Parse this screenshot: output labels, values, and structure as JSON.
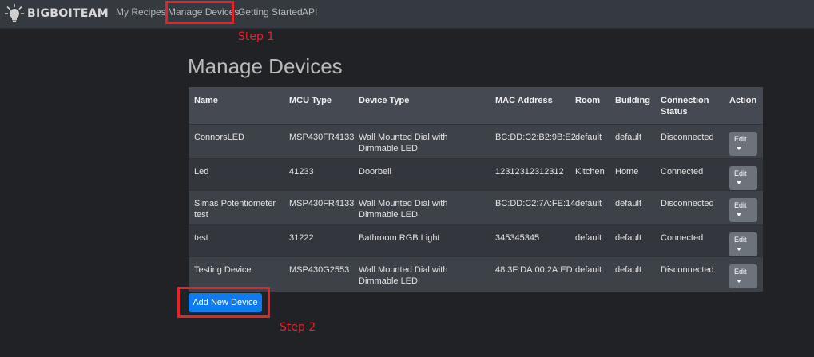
{
  "navbar": {
    "brand": "BIGBOITEAM",
    "links": [
      "My Recipes",
      "Manage Devices",
      "Getting Started",
      "API"
    ],
    "active": "Manage Devices"
  },
  "annotations": {
    "step1": "Step 1",
    "step2": "Step 2",
    "color": "#e0262b"
  },
  "page_title": "Manage Devices",
  "table": {
    "headers": [
      "Name",
      "MCU Type",
      "Device Type",
      "MAC Address",
      "Room",
      "Building",
      "Connection Status",
      "Action"
    ],
    "rows": [
      [
        "ConnorsLED",
        "MSP430FR4133",
        "Wall Mounted Dial with Dimmable LED",
        "BC:DD:C2:B2:9B:E2",
        "default",
        "default",
        "Disconnected",
        "Edit"
      ],
      [
        "Led",
        "41233",
        "Doorbell",
        "12312312312312",
        "Kitchen",
        "Home",
        "Connected",
        "Edit"
      ],
      [
        "Simas Potentiometer test",
        "MSP430FR4133",
        "Wall Mounted Dial with Dimmable LED",
        "BC:DD:C2:7A:FE:14",
        "default",
        "default",
        "Disconnected",
        "Edit"
      ],
      [
        "test",
        "31222",
        "Bathroom RGB Light",
        "345345345",
        "default",
        "default",
        "Connected",
        "Edit"
      ],
      [
        "Testing Device",
        "MSP430G2553",
        "Wall Mounted Dial with Dimmable LED",
        "48:3F:DA:00:2A:ED",
        "default",
        "default",
        "Disconnected",
        "Edit"
      ]
    ]
  },
  "add_button": "Add New Device",
  "colors": {
    "navbar": "#343a40",
    "background": "#212226",
    "primary": "#0d7cf2",
    "edit_button": "#6c737b"
  }
}
